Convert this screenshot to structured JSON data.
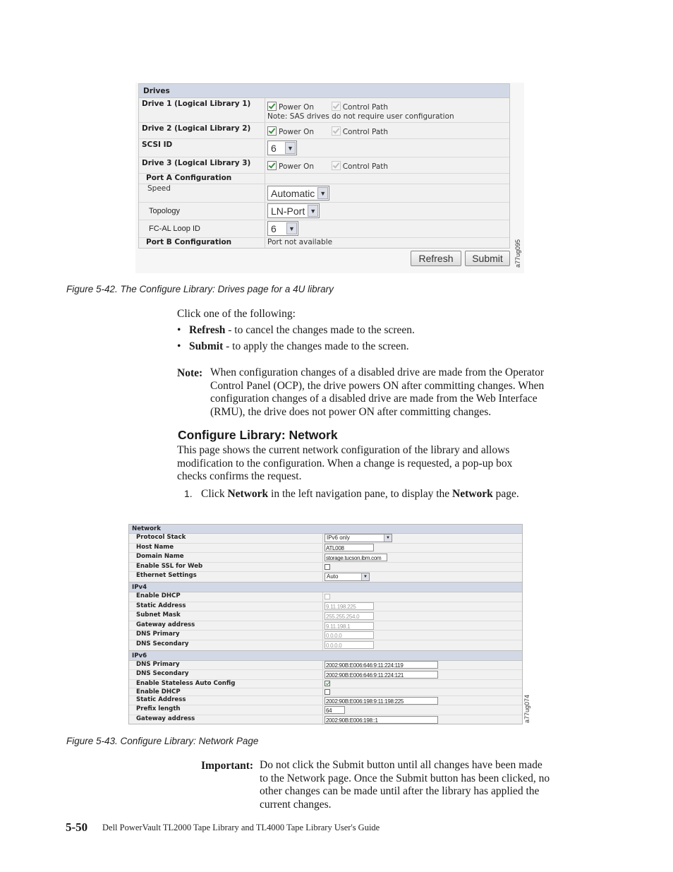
{
  "figure1": {
    "section_header": "Drives",
    "rows": [
      {
        "label": "Drive 1 (Logical Library 1)",
        "power_on_label": "Power On",
        "power_on": true,
        "control_path_label": "Control Path",
        "control_path": true,
        "note": "Note: SAS drives do not require user configuration"
      },
      {
        "label": "Drive 2 (Logical Library 2)",
        "power_on_label": "Power On",
        "power_on": true,
        "control_path_label": "Control Path",
        "control_path": true
      },
      {
        "label": "SCSI ID",
        "select_value": "6"
      },
      {
        "label": "Drive 3 (Logical Library 3)",
        "power_on_label": "Power On",
        "power_on": true,
        "control_path_label": "Control Path",
        "control_path": true
      },
      {
        "label": "Port A Configuration"
      },
      {
        "label": "Speed",
        "select_value": "Automatic"
      },
      {
        "label": "Topology",
        "select_value": "LN-Port"
      },
      {
        "label": "FC-AL Loop ID",
        "select_value": "6"
      },
      {
        "label": "Port B Configuration",
        "value": "Port not available"
      }
    ],
    "buttons": {
      "refresh": "Refresh",
      "submit": "Submit"
    },
    "figure_id": "a77ug095",
    "caption": "Figure 5-42. The Configure Library: Drives page for a 4U library"
  },
  "text": {
    "intro": "Click one of the following:",
    "bullets": [
      {
        "bold": "Refresh",
        "rest": " - to cancel the changes made to the screen."
      },
      {
        "bold": "Submit",
        "rest": " - to apply the changes made to the screen."
      }
    ],
    "note_label": "Note:",
    "note_lines": [
      "When configuration changes of a disabled drive are made from the Operator",
      "Control Panel (OCP), the drive powers ON after committing changes. When",
      "configuration changes of a disabled drive are made from the Web Interface",
      "(RMU), the drive does not power ON after committing changes."
    ],
    "section_title": "Configure Library: Network",
    "section_lines": [
      "This page shows the current network configuration of the library and allows",
      "modification to the configuration. When a change is requested, a pop-up box",
      "checks confirms the request."
    ],
    "step_num": "1.",
    "step": {
      "a": "Click ",
      "b1": "Network",
      "c": " in the left navigation pane, to display the ",
      "b2": "Network",
      "d": " page."
    },
    "important_label": "Important:",
    "important_lines": [
      "Do not click the Submit button until all changes have been made",
      "to the Network page. Once the Submit button has been clicked, no",
      "other changes can be made until after the library has applied the",
      "current changes."
    ]
  },
  "figure2": {
    "network": {
      "header": "Network",
      "protocol_stack": {
        "label": "Protocol Stack",
        "value": "IPv6 only"
      },
      "host_name": {
        "label": "Host Name",
        "value": "ATL008"
      },
      "domain_name": {
        "label": "Domain Name",
        "value": "storage.tucson.ibm.com"
      },
      "enable_ssl": {
        "label": "Enable SSL for Web",
        "checked": false
      },
      "ethernet": {
        "label": "Ethernet Settings",
        "value": "Auto"
      }
    },
    "ipv4": {
      "header": "IPv4",
      "enable_dhcp": {
        "label": "Enable DHCP",
        "checked": false
      },
      "static_address": {
        "label": "Static Address",
        "value": "9.11.198.225"
      },
      "subnet_mask": {
        "label": "Subnet Mask",
        "value": "255.255.254.0"
      },
      "gateway": {
        "label": "Gateway address",
        "value": "9.11.198.1"
      },
      "dns_primary": {
        "label": "DNS Primary",
        "value": "0.0.0.0"
      },
      "dns_secondary": {
        "label": "DNS Secondary",
        "value": "0.0.0.0"
      }
    },
    "ipv6": {
      "header": "IPv6",
      "dns_primary": {
        "label": "DNS Primary",
        "value": "2002:90B:E006:646:9:11:224:119"
      },
      "dns_secondary": {
        "label": "DNS Secondary",
        "value": "2002:90B:E006:646:9:11:224:121"
      },
      "stateless": {
        "label": "Enable Stateless Auto Config",
        "checked": true
      },
      "enable_dhcp": {
        "label": "Enable DHCP",
        "checked": false
      },
      "static_address": {
        "label": "Static Address",
        "value": "2002:90B:E006:198:9:11:198:225"
      },
      "prefix": {
        "label": "Prefix length",
        "value": "64"
      },
      "gateway": {
        "label": "Gateway address",
        "value": "2002:90B:E006:198::1"
      }
    },
    "figure_id": "a77ug074",
    "caption": "Figure 5-43. Configure Library: Network Page"
  },
  "footer": {
    "page_number": "5-50",
    "title": "Dell PowerVault TL2000 Tape Library and TL4000 Tape Library User's Guide"
  }
}
